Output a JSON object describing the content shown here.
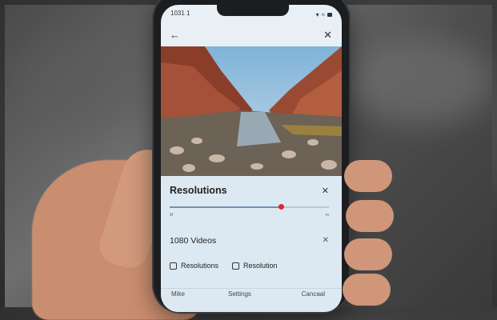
{
  "status_bar": {
    "time": "1031 1"
  },
  "sheet": {
    "title": "Resolutions",
    "slider_value": 0.7,
    "tick_left": "M",
    "tick_right": "m",
    "resolution_value": "1080 Videos",
    "options": [
      "Resolutions",
      "Resolution"
    ],
    "footer": [
      "Mike",
      "Settings",
      "Cancaal"
    ]
  },
  "colors": {
    "accent": "#e3242b",
    "sheet_bg": "#dde9f2"
  }
}
